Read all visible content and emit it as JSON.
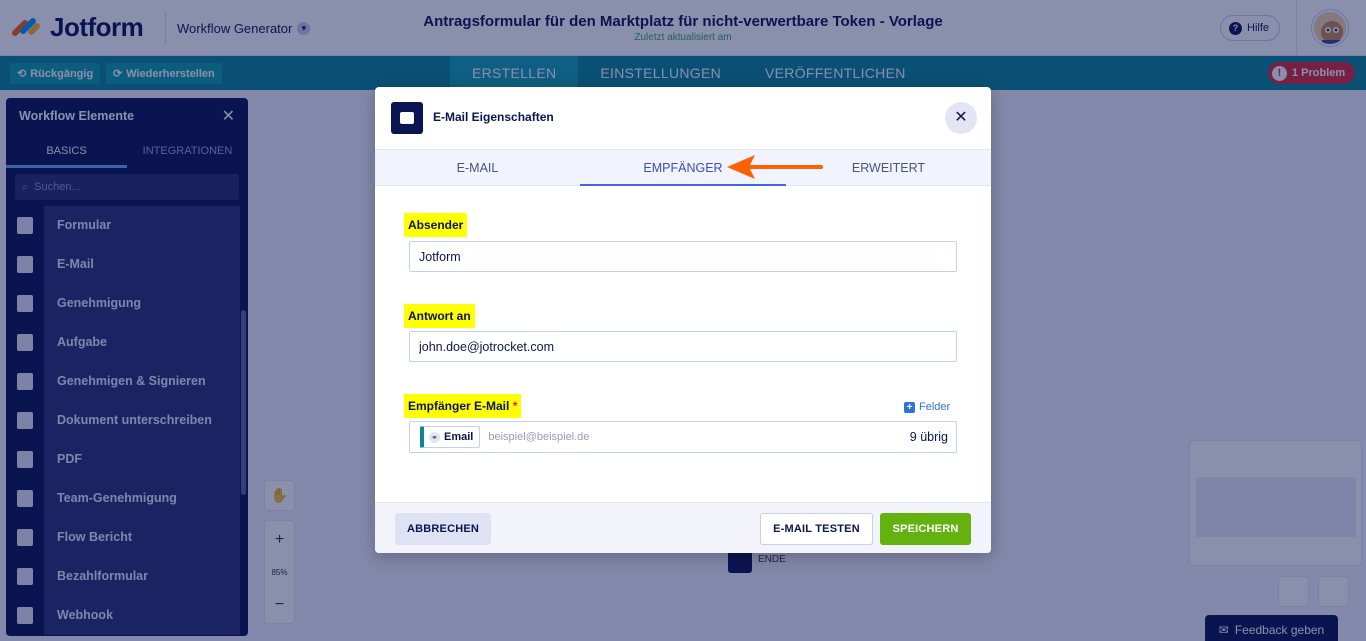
{
  "header": {
    "logo_text": "Jotform",
    "workflow_generator": "Workflow Generator",
    "form_title": "Antragsformular für den Marktplatz für nicht-verwertbare Token - Vorlage",
    "last_updated": "Zuletzt aktualisiert am",
    "help_label": "Hilfe"
  },
  "toolbar": {
    "undo_label": "Rückgängig",
    "redo_label": "Wiederherstellen",
    "tabs": [
      {
        "label": "ERSTELLEN"
      },
      {
        "label": "EINSTELLUNGEN"
      },
      {
        "label": "VERÖFFENTLICHEN"
      }
    ],
    "problem_label": "1 Problem"
  },
  "sidebar": {
    "title": "Workflow Elemente",
    "tabs": [
      {
        "label": "BASICS"
      },
      {
        "label": "INTEGRATIONEN"
      }
    ],
    "search_placeholder": "Suchen...",
    "items": [
      {
        "label": "Formular",
        "icon": "form-icon"
      },
      {
        "label": "E-Mail",
        "icon": "email-icon"
      },
      {
        "label": "Genehmigung",
        "icon": "approval-icon"
      },
      {
        "label": "Aufgabe",
        "icon": "task-icon"
      },
      {
        "label": "Genehmigen & Signieren",
        "icon": "approve-sign-icon"
      },
      {
        "label": "Dokument unterschreiben",
        "icon": "sign-document-icon"
      },
      {
        "label": "PDF",
        "icon": "pdf-icon"
      },
      {
        "label": "Team-Genehmigung",
        "icon": "team-approval-icon"
      },
      {
        "label": "Flow Bericht",
        "icon": "flow-report-icon"
      },
      {
        "label": "Bezahlformular",
        "icon": "payment-form-icon"
      },
      {
        "label": "Webhook",
        "icon": "webhook-icon"
      }
    ]
  },
  "canvas": {
    "zoom_level": "85%",
    "end_node_label": "ENDE",
    "feedback_label": "Feedback geben"
  },
  "modal": {
    "title": "E-Mail Eigenschaften",
    "tabs": [
      {
        "label": "E-MAIL"
      },
      {
        "label": "EMPFÄNGER"
      },
      {
        "label": "ERWEITERT"
      }
    ],
    "active_tab": "EMPFÄNGER",
    "sender_label": "Absender",
    "sender_value": "Jotform",
    "reply_to_label": "Antwort an",
    "reply_to_value": "john.doe@jotrocket.com",
    "recipient_label": "Empfänger E-Mail",
    "recipient_required": "*",
    "fields_link": "Felder",
    "recipient_tag": "Email",
    "recipient_placeholder": "beispiel@beispiel.de",
    "recipient_remaining": "9 übrig",
    "cancel_label": "ABBRECHEN",
    "test_label": "E-MAIL TESTEN",
    "save_label": "SPEICHERN"
  },
  "colors": {
    "brand_navy": "#0a1551",
    "toolbar_teal": "#0a8796",
    "highlight_yellow": "#ffff00",
    "annotation_arrow": "#ff6100",
    "save_green": "#64b20f",
    "problem_red": "#d92b3c"
  }
}
